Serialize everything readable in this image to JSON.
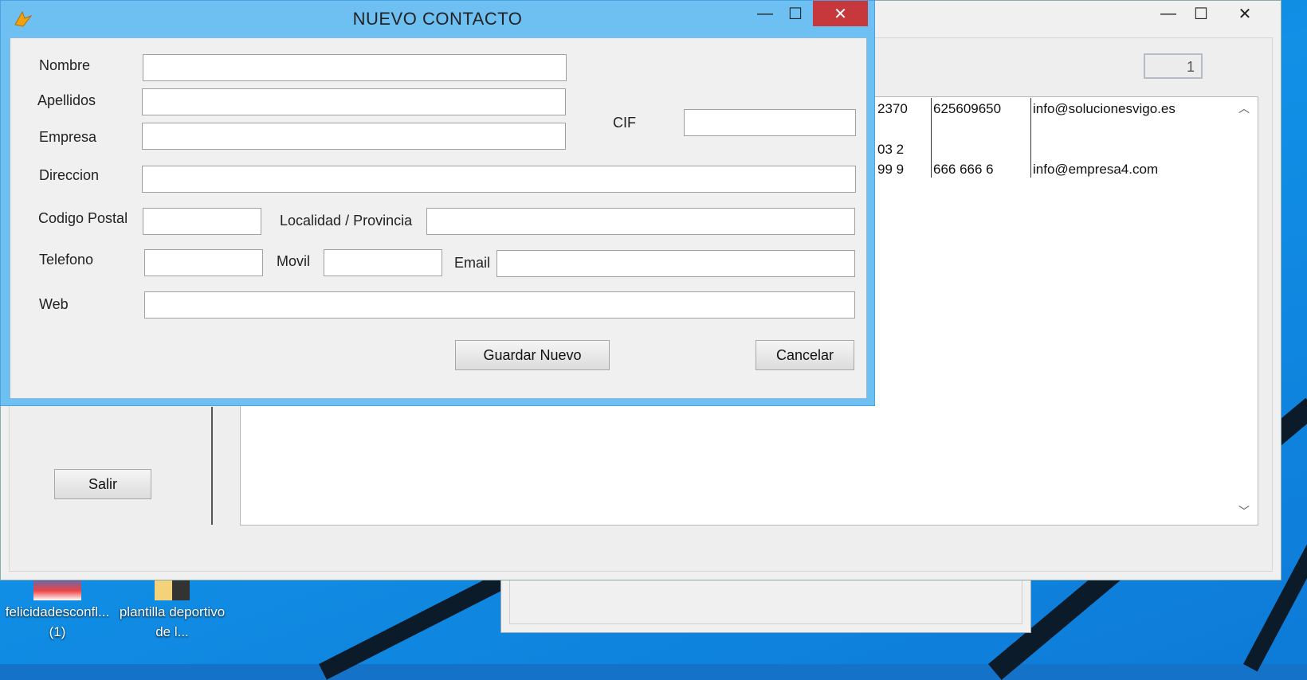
{
  "background_window": {
    "counter_value": "1",
    "table_rows": [
      [
        "2370",
        "625609650",
        "info@solucionesvigo.es"
      ],
      [
        "03 2",
        "",
        ""
      ],
      [
        "99 9",
        "666 666 6",
        "info@empresa4.com"
      ]
    ],
    "salir_label": "Salir",
    "minimize": "—",
    "maximize": "☐",
    "close": "✕"
  },
  "desktop": {
    "icons": [
      {
        "label": "felicidadesconfl... (1)"
      },
      {
        "label": "plantilla deportivo de l..."
      }
    ]
  },
  "dialog": {
    "title": "NUEVO CONTACTO",
    "minimize": "—",
    "maximize": "☐",
    "close": "✕",
    "labels": {
      "nombre": "Nombre",
      "apellidos": "Apellidos",
      "empresa": "Empresa",
      "cif": "CIF",
      "direccion": "Direccion",
      "codigo_postal": "Codigo Postal",
      "localidad": "Localidad / Provincia",
      "telefono": "Telefono",
      "movil": "Movil",
      "email": "Email",
      "web": "Web"
    },
    "values": {
      "nombre": "",
      "apellidos": "",
      "empresa": "",
      "cif": "",
      "direccion": "",
      "codigo_postal": "",
      "localidad": "",
      "telefono": "",
      "movil": "",
      "email": "",
      "web": ""
    },
    "guardar_label": "Guardar Nuevo",
    "cancelar_label": "Cancelar"
  }
}
